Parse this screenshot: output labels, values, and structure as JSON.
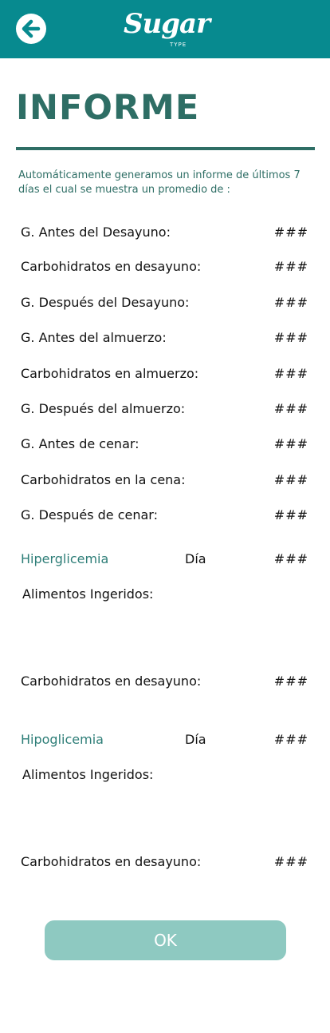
{
  "header": {
    "logo_text": "Sugar",
    "logo_subtext": "TYPE",
    "colors": {
      "header_bg": "#078a8f",
      "title": "#2e6e65",
      "button": "#8ec9c1"
    },
    "back_icon": "arrow-left-icon"
  },
  "page": {
    "title": "INFORME",
    "intro": "Automáticamente  generamos un informe de últimos 7 días el cual se muestra un promedio de :"
  },
  "averages": [
    {
      "label": "G. Antes del Desayuno:",
      "value": "###"
    },
    {
      "label": "Carbohidratos en desayuno:",
      "value": "###"
    },
    {
      "label": "G. Después del Desayuno:",
      "value": "###"
    },
    {
      "label": "G. Antes del almuerzo:",
      "value": "###"
    },
    {
      "label": "Carbohidratos en almuerzo:",
      "value": "###"
    },
    {
      "label": "G. Después del almuerzo:",
      "value": "###"
    },
    {
      "label": "G. Antes de cenar:",
      "value": "###"
    },
    {
      "label": "Carbohidratos en la cena:",
      "value": "###"
    },
    {
      "label": "G. Después de cenar:",
      "value": "###"
    }
  ],
  "hyperglycemia": {
    "label": "Hiperglicemia",
    "day_label": "Día",
    "day_value": "###",
    "foods_label": "Alimentos Ingeridos:",
    "carbs_label": "Carbohidratos en desayuno:",
    "carbs_value": "###"
  },
  "hypoglycemia": {
    "label": "Hipoglicemia",
    "day_label": "Día",
    "day_value": "###",
    "foods_label": "Alimentos Ingeridos:",
    "carbs_label": "Carbohidratos en desayuno:",
    "carbs_value": "###"
  },
  "actions": {
    "ok_label": "OK"
  }
}
